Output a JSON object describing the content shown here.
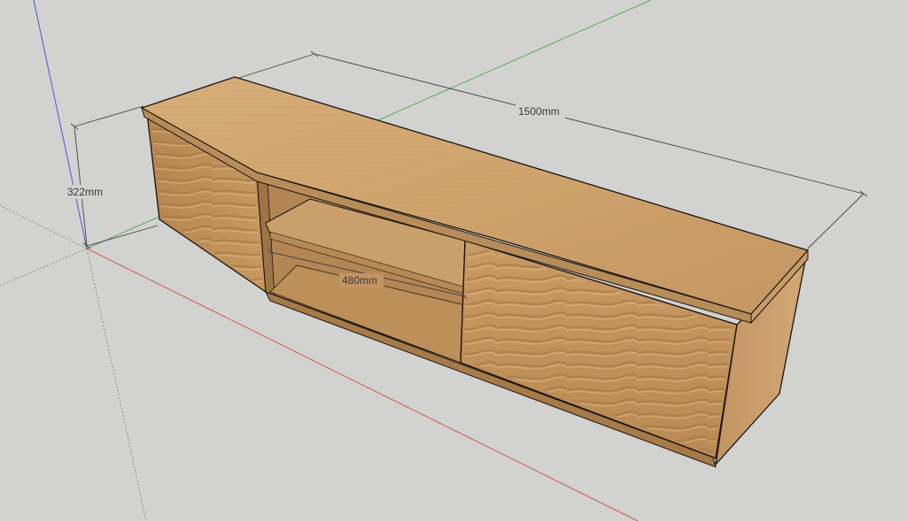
{
  "dimensions": {
    "width_label": "1500mm",
    "height_label": "322mm",
    "depth_label": "480mm"
  },
  "colors": {
    "background": "#d2d3d0",
    "axis_red": "#c8453f",
    "axis_green": "#3fa43f",
    "axis_blue": "#3a3fd0",
    "wood_top": "#caa16d",
    "wood_front": "#c2945d",
    "wood_side": "#b98b55",
    "wood_inner": "#a9804e",
    "edge": "#1a1410"
  }
}
